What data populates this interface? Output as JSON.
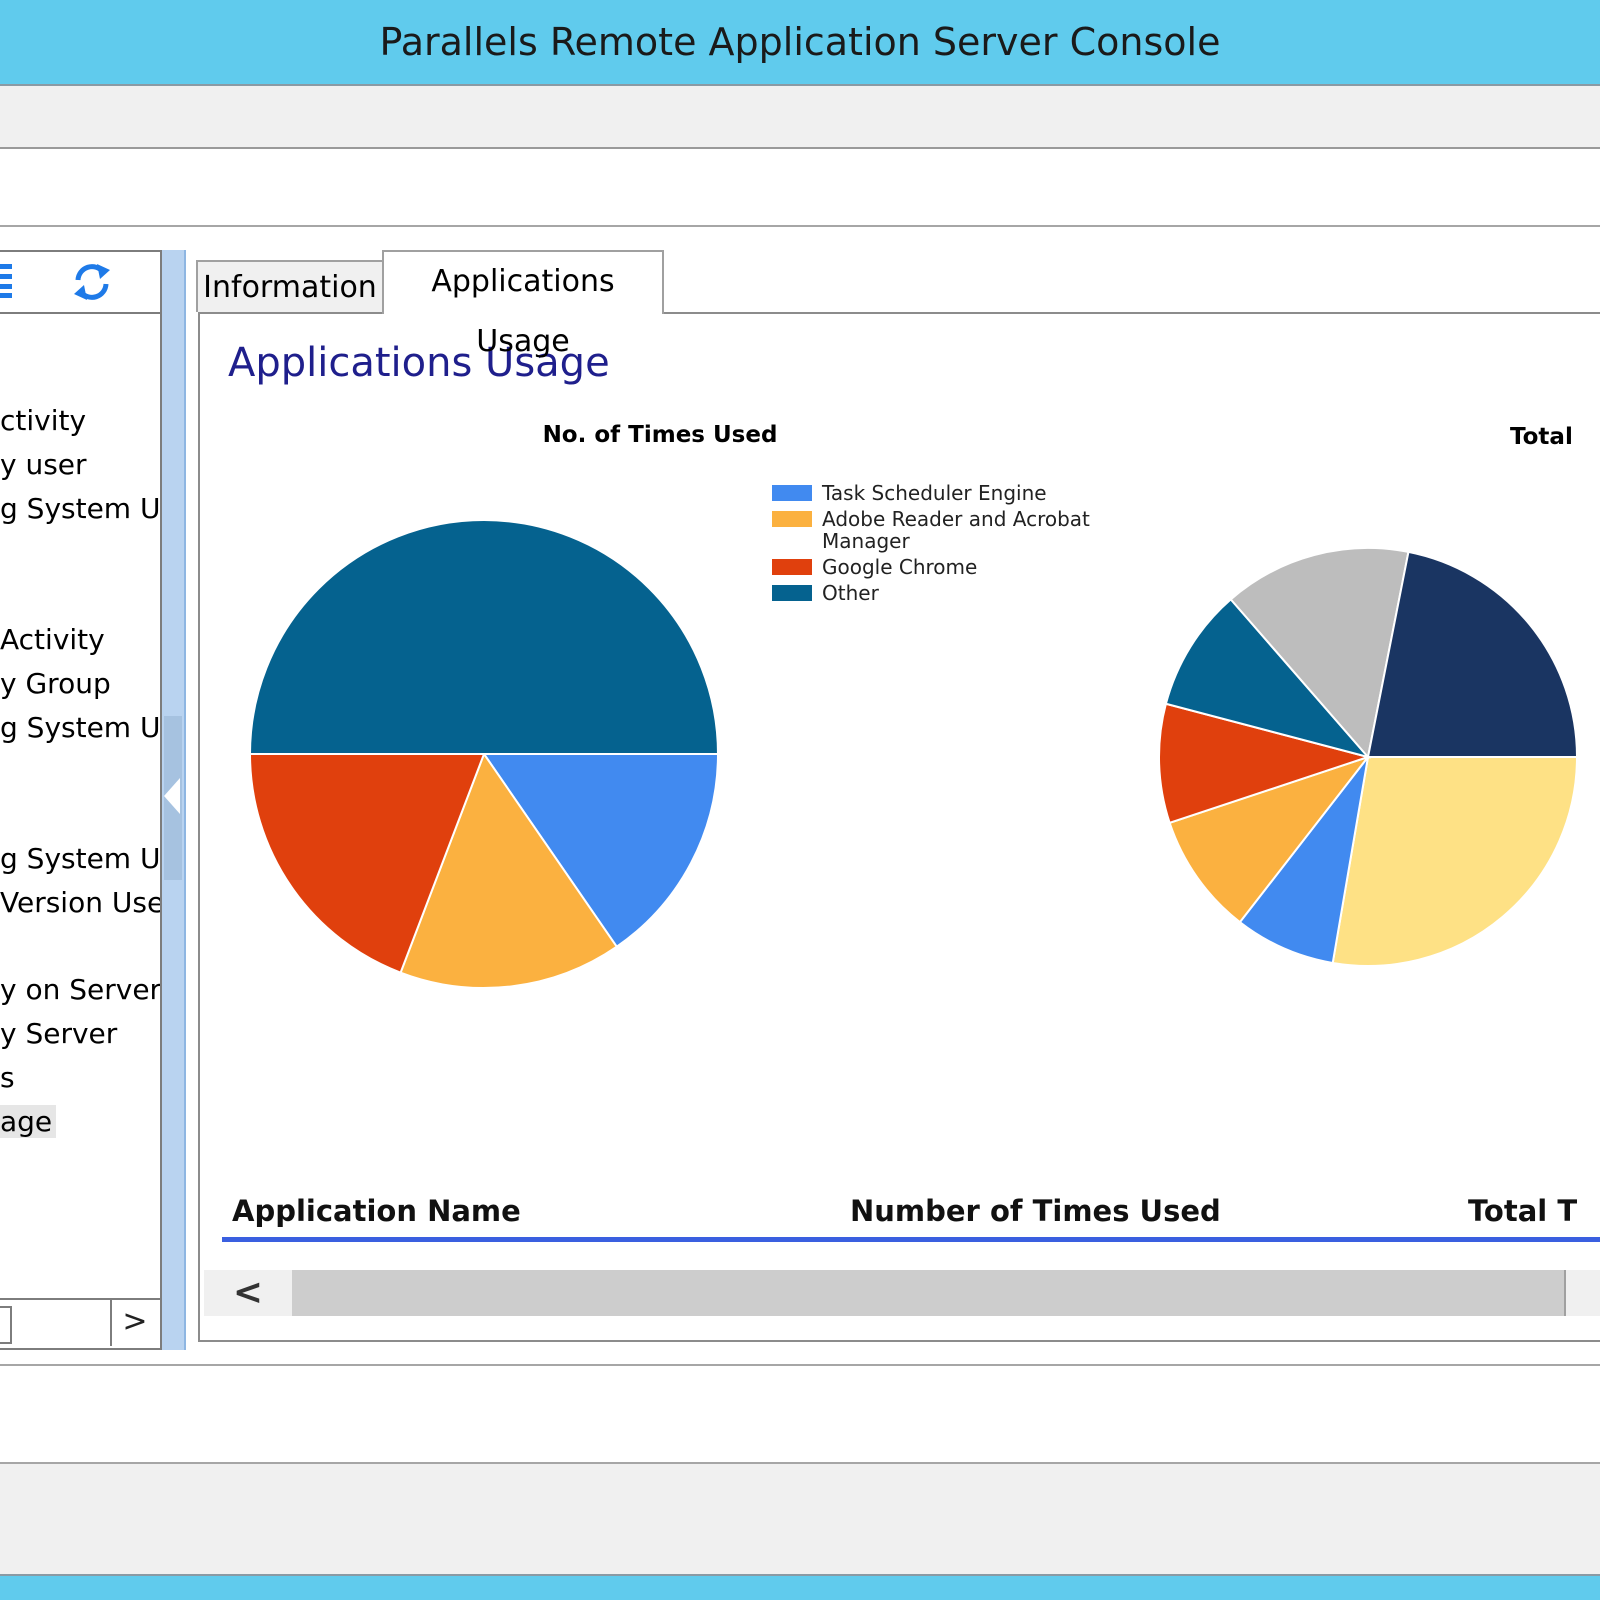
{
  "window": {
    "title": "Parallels Remote Application Server Console"
  },
  "icons": {
    "list": "list-icon",
    "refresh": "refresh-icon",
    "collapse": "chevron-left-icon",
    "scroll_left": "chevron-left-icon",
    "scroll_right": "chevron-right-icon"
  },
  "sidebar": {
    "items": [
      {
        "label": "ctivity"
      },
      {
        "label": "y user"
      },
      {
        "label": "g System Use"
      },
      {
        "label": "Activity"
      },
      {
        "label": "y Group"
      },
      {
        "label": "g System Use"
      },
      {
        "label": "g System Use"
      },
      {
        "label": "Version Used"
      },
      {
        "label": "y on Server"
      },
      {
        "label": "y Server"
      },
      {
        "label": "s"
      },
      {
        "label": "age"
      }
    ],
    "scroll_right": ">"
  },
  "tabs": [
    {
      "label": "Information"
    },
    {
      "label": "Applications Usage"
    }
  ],
  "content": {
    "title": "Applications Usage",
    "table": {
      "columns": [
        "Application Name",
        "Number of Times Used",
        "Total T"
      ]
    },
    "scroll_left": "<"
  },
  "colors": {
    "titlebar": "#60cbed",
    "accent": "#3a5fe0",
    "heading": "#1f1f8c"
  },
  "chart_data": [
    {
      "type": "pie",
      "title": "No. of Times Used",
      "legend": "right",
      "slices": [
        {
          "label": "Task Scheduler Engine",
          "value": 15.4,
          "color": "#418af0"
        },
        {
          "label": "Adobe Reader and Acrobat Manager",
          "value": 15.4,
          "color": "#fbb140"
        },
        {
          "label": "Google Chrome",
          "value": 19.2,
          "color": "#e0400d"
        },
        {
          "label": "Other",
          "value": 50,
          "color": "#05628f"
        }
      ]
    },
    {
      "type": "pie",
      "title": "Total",
      "slices": [
        {
          "value": 27.7,
          "color": "#fee185"
        },
        {
          "value": 7.8,
          "color": "#418af0"
        },
        {
          "value": 9.4,
          "color": "#fbb140"
        },
        {
          "value": 9.2,
          "color": "#e0400d"
        },
        {
          "value": 9.5,
          "color": "#05628f"
        },
        {
          "value": 14.5,
          "color": "#bdbdbd"
        },
        {
          "value": 21.9,
          "color": "#1a3562"
        }
      ]
    }
  ]
}
